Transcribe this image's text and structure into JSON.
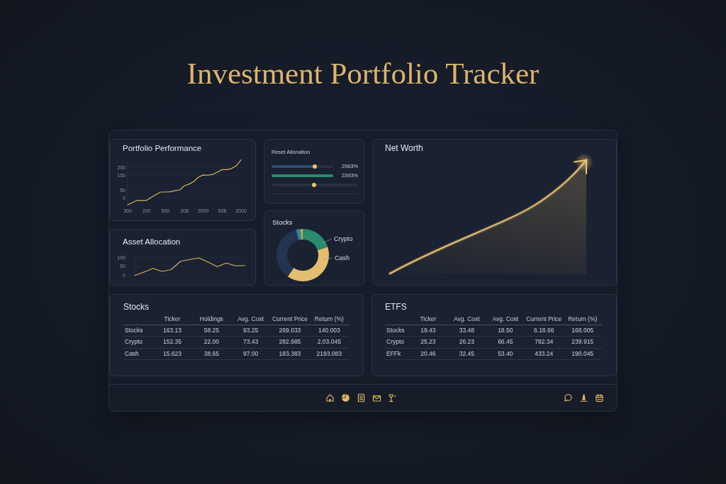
{
  "title": "Investment Portfolio Tracker",
  "performance": {
    "title": "Portfolio Performance",
    "chart_data": {
      "type": "line",
      "grid": true,
      "categories": [
        "300",
        null,
        null,
        null,
        "200",
        null,
        null,
        null,
        "500",
        null,
        null,
        null,
        "208",
        null,
        null,
        null,
        "2000",
        null,
        null,
        null,
        "508",
        null,
        null,
        null,
        "2000"
      ],
      "series": [
        {
          "color": "#d9b263",
          "values": [
            -46,
            -32,
            -17,
            -17,
            -17,
            3,
            22,
            38,
            38,
            40,
            47,
            52,
            79,
            90,
            108,
            136,
            151,
            149,
            154,
            170,
            186,
            186,
            193,
            212,
            250
          ]
        }
      ],
      "ylim": [
        -46,
        250
      ],
      "yticks": [
        0,
        50,
        150,
        200
      ]
    }
  },
  "allocation_levels": {
    "title": "Reset Allonaiton",
    "rows": [
      {
        "kind": "slider",
        "color": "#2f4d74",
        "level": 0.7,
        "reading": "2983%"
      },
      {
        "kind": "bar",
        "color": "#2a8c6e",
        "level": 1,
        "reading": "2393%"
      },
      {
        "kind": "handle",
        "level": 0.49
      }
    ]
  },
  "net_worth": {
    "title": "Net Worth"
  },
  "asset_allocation": {
    "title": "Asset Allocation",
    "chart_data": {
      "type": "line",
      "grid": true,
      "categories": [
        null,
        null,
        null,
        null,
        null,
        null,
        null,
        null,
        null,
        null,
        null,
        null,
        null
      ],
      "series": [
        {
          "color": "#d9b263",
          "values": [
            -3,
            16,
            37,
            20,
            31,
            77,
            87,
            96,
            73,
            47,
            67,
            52,
            53
          ]
        }
      ],
      "ylim": [
        -3,
        100
      ],
      "yticks": [
        0,
        50,
        100
      ]
    }
  },
  "holdings_donut": {
    "title": "Stocks",
    "labels": [
      "Crypto",
      "Cash"
    ]
  },
  "tables": [
    {
      "title": "Stocks",
      "columns": [
        "Ticker",
        "Holdings",
        "Avg. Cost",
        "Current Price",
        "Return (%)"
      ],
      "rows": [
        {
          "name": "Stocks",
          "cells": [
            "163.13",
            "58.25",
            "93.25",
            "269.033",
            "140.003"
          ]
        },
        {
          "name": "Crypto",
          "cells": [
            "152.35",
            "22.00",
            "73.43",
            "282.685",
            "2.03.045"
          ]
        },
        {
          "name": "Cash",
          "cells": [
            "15.623",
            "38.65",
            "97.00",
            "183.383",
            "2193.083"
          ]
        }
      ]
    },
    {
      "title": "ETFS",
      "columns": [
        "Ticker",
        "Avg. Cost",
        "Avg. Cost",
        "Current Price",
        "Return (%)"
      ],
      "rows": [
        {
          "name": "Stocks",
          "cells": [
            "19.43",
            "33.48",
            "18.50",
            "6.18.66",
            "168.005"
          ]
        },
        {
          "name": "Crypto",
          "cells": [
            "25.23",
            "26.23",
            "66.45",
            "782.34",
            "239.915"
          ]
        },
        {
          "name": "EFFk",
          "cells": [
            "20.46",
            "32.45",
            "53.40",
            "433.24",
            "190.045"
          ]
        }
      ]
    }
  ]
}
